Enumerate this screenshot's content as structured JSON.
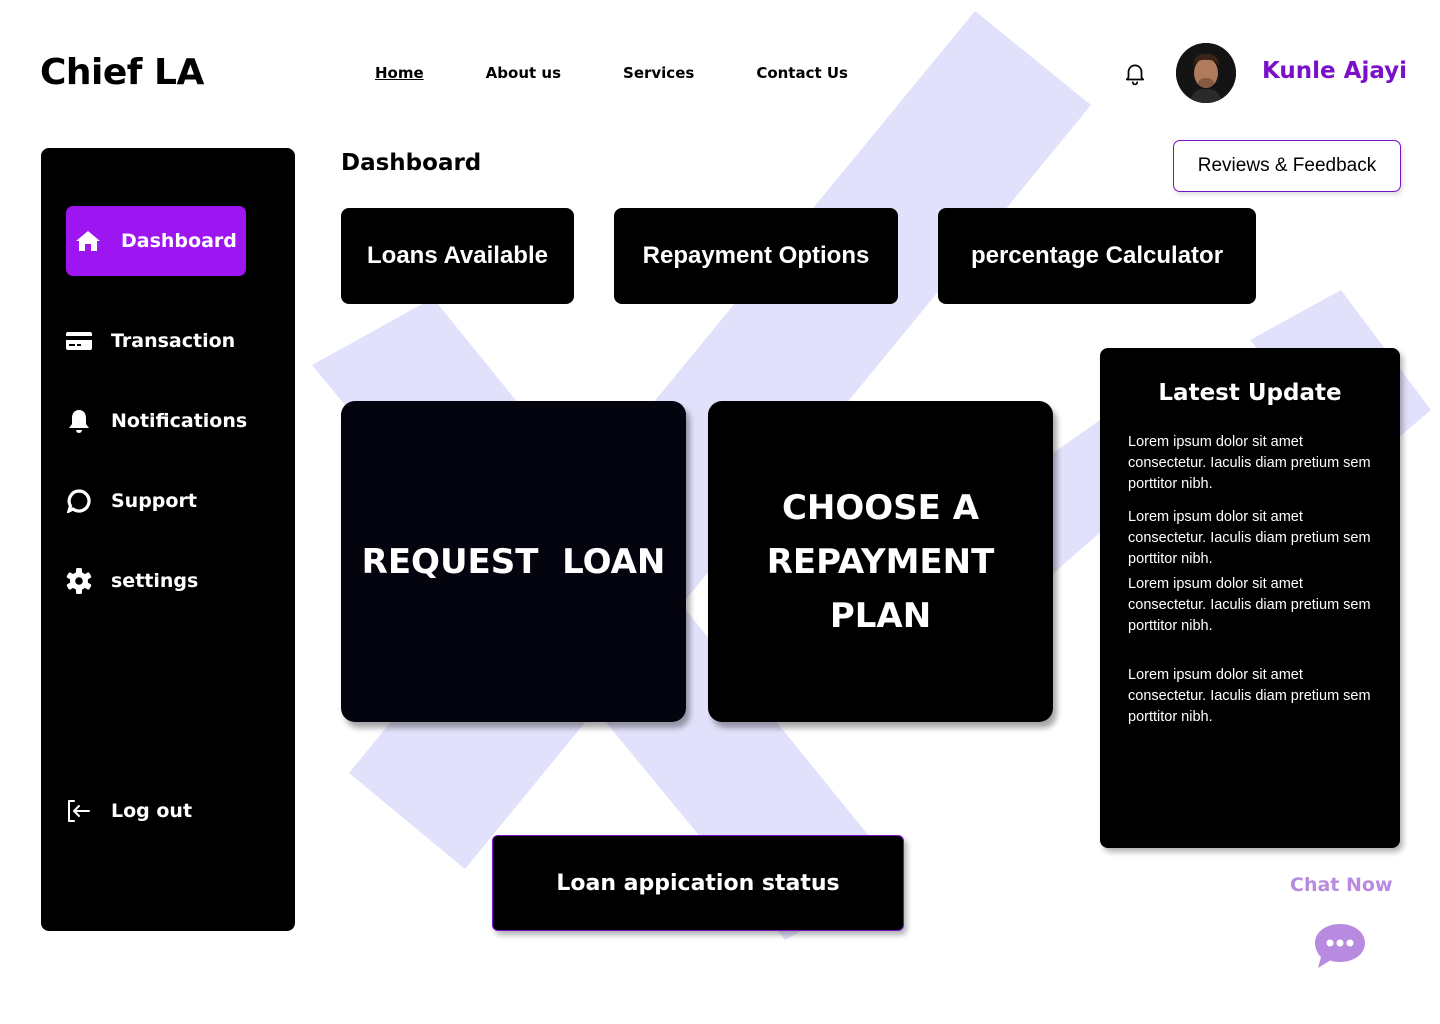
{
  "header": {
    "logo": "Chief LA",
    "nav": [
      {
        "label": "Home",
        "active": true
      },
      {
        "label": "About us"
      },
      {
        "label": "Services"
      },
      {
        "label": "Contact Us"
      }
    ],
    "user_name": "Kunle Ajayi",
    "icons": {
      "notification": "bell-icon",
      "avatar": "user-avatar"
    }
  },
  "sidebar": {
    "items": [
      {
        "label": "Dashboard",
        "icon": "home-icon",
        "active": true
      },
      {
        "label": "Transaction",
        "icon": "credit-card-icon"
      },
      {
        "label": "Notifications",
        "icon": "bell-icon"
      },
      {
        "label": "Support",
        "icon": "chat-bubble-icon"
      },
      {
        "label": "settings",
        "icon": "gear-icon"
      }
    ],
    "logout": {
      "label": "Log out",
      "icon": "logout-icon"
    }
  },
  "main": {
    "title": "Dashboard",
    "reviews_button": "Reviews & Feedback",
    "chips": [
      "Loans Available",
      "Repayment Options",
      "percentage Calculator"
    ],
    "cards": [
      {
        "lines": [
          "REQUEST  LOAN"
        ]
      },
      {
        "lines": [
          "CHOOSE A",
          "REPAYMENT",
          "PLAN"
        ]
      }
    ],
    "status_button": "Loan appication status"
  },
  "latest_update": {
    "title": "Latest Update",
    "items": [
      "Lorem ipsum dolor sit amet consectetur. Iaculis diam pretium sem porttitor nibh.",
      "Lorem ipsum dolor sit amet consectetur. Iaculis diam pretium sem porttitor nibh.",
      "Lorem ipsum dolor sit amet consectetur. Iaculis diam pretium sem porttitor nibh.",
      "Lorem ipsum dolor sit amet consectetur. Iaculis diam pretium sem porttitor nibh."
    ]
  },
  "chat": {
    "label": "Chat Now",
    "icon": "chat-dots-icon"
  },
  "colors": {
    "accent_purple": "#9d16f2",
    "username_purple": "#7a10c9",
    "chat_purple": "#b88be0",
    "panel_black": "#000000",
    "background_shape": "#e2e1fb"
  }
}
